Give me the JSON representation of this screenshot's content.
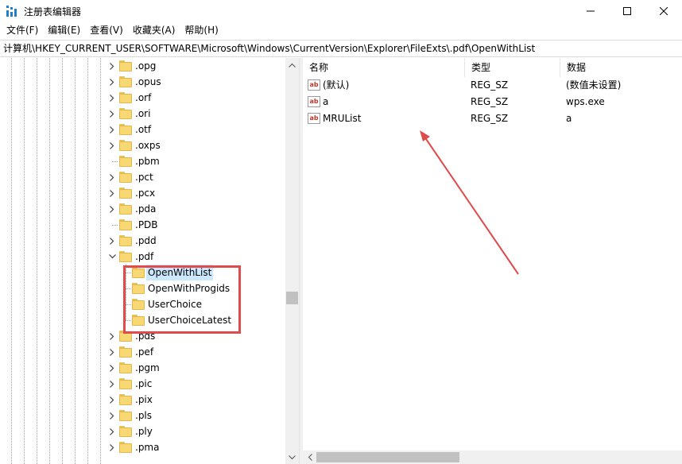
{
  "window": {
    "title": "注册表编辑器",
    "accent": "#1f7fc9"
  },
  "menu": [
    "文件(F)",
    "编辑(E)",
    "查看(V)",
    "收藏夹(A)",
    "帮助(H)"
  ],
  "address": "计算机\\HKEY_CURRENT_USER\\SOFTWARE\\Microsoft\\Windows\\CurrentVersion\\Explorer\\FileExts\\.pdf\\OpenWithList",
  "tree": {
    "items": [
      {
        "label": ".opg",
        "expander": "chevron-right"
      },
      {
        "label": ".opus",
        "expander": "chevron-right"
      },
      {
        "label": ".orf",
        "expander": "chevron-right"
      },
      {
        "label": ".ori",
        "expander": "chevron-right"
      },
      {
        "label": ".otf",
        "expander": "chevron-right"
      },
      {
        "label": ".oxps",
        "expander": "chevron-right"
      },
      {
        "label": ".pbm",
        "expander": "none"
      },
      {
        "label": ".pct",
        "expander": "chevron-right"
      },
      {
        "label": ".pcx",
        "expander": "chevron-right"
      },
      {
        "label": ".pda",
        "expander": "chevron-right"
      },
      {
        "label": ".PDB",
        "expander": "none"
      },
      {
        "label": ".pdd",
        "expander": "chevron-right"
      },
      {
        "label": ".pdf",
        "expander": "chevron-down"
      },
      {
        "label": "OpenWithList",
        "expander": "child",
        "selected": true
      },
      {
        "label": "OpenWithProgids",
        "expander": "child"
      },
      {
        "label": "UserChoice",
        "expander": "child"
      },
      {
        "label": "UserChoiceLatest",
        "expander": "child"
      },
      {
        "label": ".pds",
        "expander": "chevron-right"
      },
      {
        "label": ".pef",
        "expander": "chevron-right"
      },
      {
        "label": ".pgm",
        "expander": "chevron-right"
      },
      {
        "label": ".pic",
        "expander": "chevron-right"
      },
      {
        "label": ".pix",
        "expander": "chevron-right"
      },
      {
        "label": ".pls",
        "expander": "chevron-right"
      },
      {
        "label": ".ply",
        "expander": "chevron-right"
      },
      {
        "label": ".pma",
        "expander": "chevron-right"
      }
    ]
  },
  "values": {
    "columns": [
      "名称",
      "类型",
      "数据"
    ],
    "rows": [
      {
        "name": "(默认)",
        "type": "REG_SZ",
        "data": "(数值未设置)",
        "icon": "ab"
      },
      {
        "name": "a",
        "type": "REG_SZ",
        "data": "wps.exe",
        "icon": "ab"
      },
      {
        "name": "MRUList",
        "type": "REG_SZ",
        "data": "a",
        "icon": "ab"
      }
    ]
  },
  "annotation": {
    "color": "#e04b4b"
  }
}
